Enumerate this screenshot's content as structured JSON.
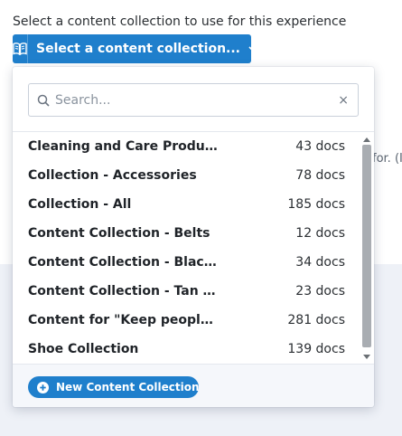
{
  "prompt": "Select a content collection to use for this experience",
  "trigger": {
    "label": "Select a content collection...",
    "icon": "book-icon"
  },
  "background": {
    "partial_text": "for. (I"
  },
  "search": {
    "placeholder": "Search...",
    "clear_symbol": "×"
  },
  "collections": [
    {
      "name": "Cleaning and Care Products",
      "count": "43 docs"
    },
    {
      "name": "Collection - Accessories",
      "count": "78 docs"
    },
    {
      "name": "Collection - All",
      "count": "185 docs"
    },
    {
      "name": "Content Collection - Belts",
      "count": "12 docs"
    },
    {
      "name": "Content Collection - Black Shoes",
      "count": "34 docs"
    },
    {
      "name": "Content Collection - Tan Shoes",
      "count": "23 docs"
    },
    {
      "name": "Content for \"Keep people on site\"",
      "count": "281 docs"
    },
    {
      "name": "Shoe Collection",
      "count": "139 docs"
    }
  ],
  "footer": {
    "new_button_label": "New Content Collection"
  },
  "colors": {
    "accent": "#1f7fcc",
    "band": "#eef1f7",
    "scroll_thumb": "#a9adb2"
  }
}
